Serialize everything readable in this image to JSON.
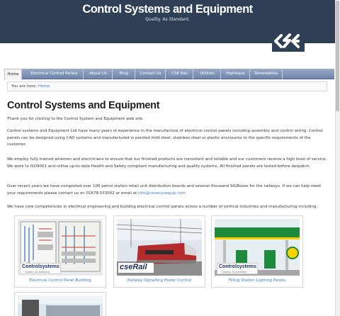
{
  "header": {
    "title": "Control Systems and Equipment",
    "tagline": "Quality. As Standard."
  },
  "nav": {
    "items": [
      {
        "label": "Home",
        "active": true
      },
      {
        "label": "Electrical Control Panels"
      },
      {
        "label": "About Us"
      },
      {
        "label": "Blog"
      },
      {
        "label": "Contact Us"
      },
      {
        "label": "CSE Rail"
      },
      {
        "label": "Utilities"
      },
      {
        "label": "Highways"
      },
      {
        "label": "Renewables"
      }
    ]
  },
  "breadcrumb": {
    "prefix": "You are here:",
    "home": "Home"
  },
  "page": {
    "title": "Control Systems and Equipment",
    "p1": "Thank you for clicking to the Control System and Equipment web site.",
    "p2": "Control systems and Equipment Ltd have many years of experience in the manufacture of electrical control panels including assembly and control wiring. Control panels can be designed using CAD systems and manufactured in painted mild steel, stainless steel or plastic enclosures to the specific requirements of the customer.",
    "p3": "We employ fully trained wiremen and electricians to ensure that our finished products are consistent and reliable and our customers receive a high level of service. We work to ISO9001 and utilise up-to-date Health and Safety compliant manufacturing and quality systems. All finished panels are tested before despatch.",
    "p4_text": "Over recent years we have completed over 100 petrol station retail unit distribution boards and several thousand SIGBoxes for the railways. If we can help meet your requirements please contact us on 01678 533002 or email at ",
    "p4_email": "info@conesysequip.com",
    "p5": "We have core competencies in electrical engineering and building electrical control panels across a number of vertical industries and manufacturing including :"
  },
  "cards": [
    {
      "label": "Electrical Control Panel Building",
      "logo": "Controlsystems",
      "logo_tag": "Quality. As standard"
    },
    {
      "label": "Railway Signalling Power Control",
      "logo": "cseRail"
    },
    {
      "label": "Filling Station Lighting Panels",
      "logo": "Controlsystems",
      "logo_tag": "Quality. As standard"
    }
  ],
  "colors": {
    "header_bg": "#2f3f55",
    "link": "#3a7bd5",
    "nav": "#7a8db3"
  }
}
